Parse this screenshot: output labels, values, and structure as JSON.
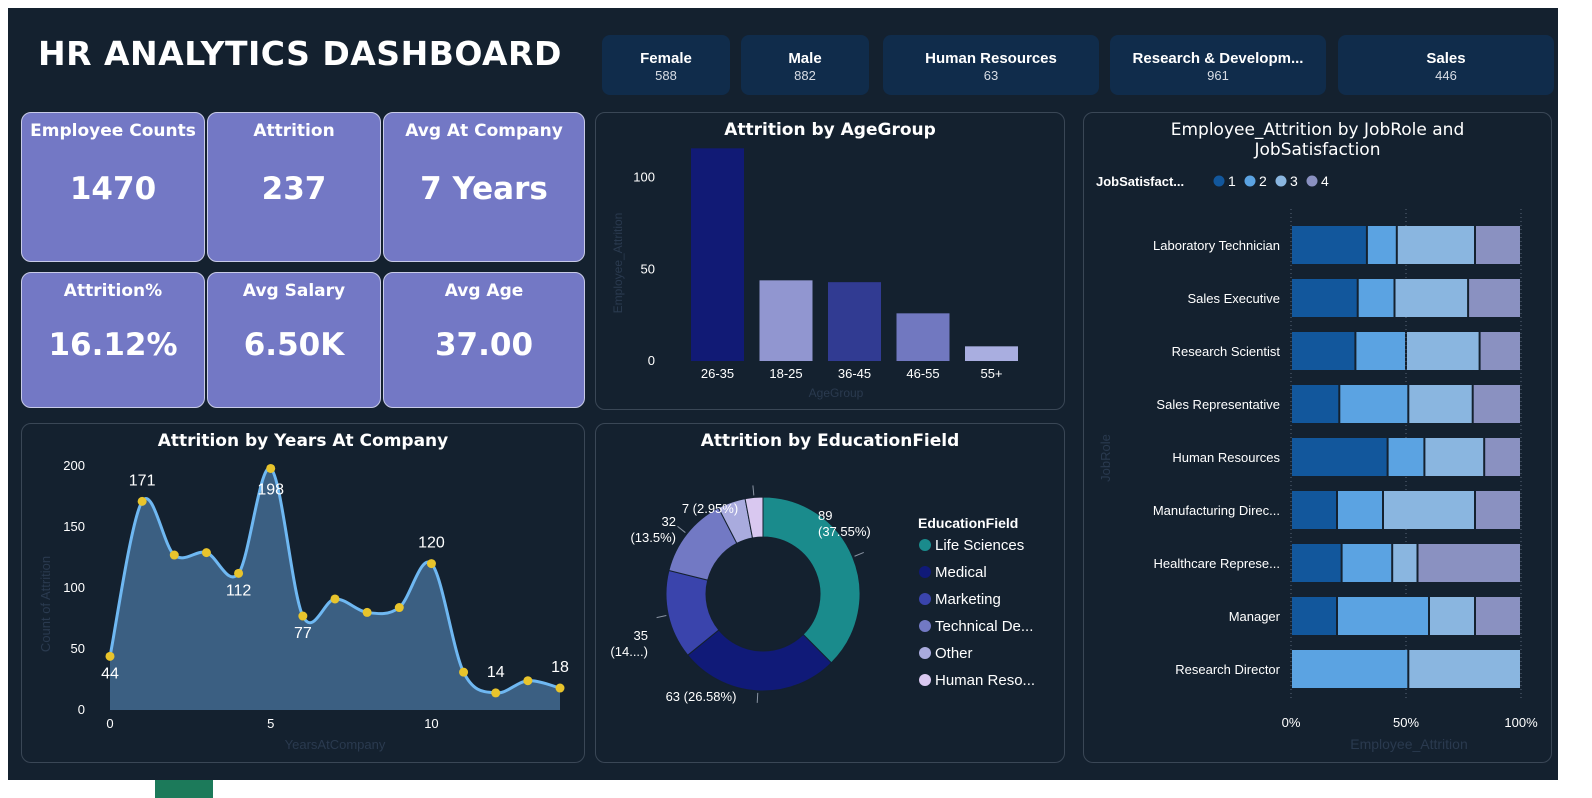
{
  "title": "HR ANALYTICS DASHBOARD",
  "slicers": [
    {
      "label": "Female",
      "value": "588"
    },
    {
      "label": "Male",
      "value": "882"
    },
    {
      "label": "Human Resources",
      "value": "63"
    },
    {
      "label": "Research & Developm...",
      "value": "961"
    },
    {
      "label": "Sales",
      "value": "446"
    }
  ],
  "kpis": [
    {
      "label": "Employee Counts",
      "value": "1470"
    },
    {
      "label": "Attrition",
      "value": "237"
    },
    {
      "label": "Avg At Company",
      "value": "7 Years"
    },
    {
      "label": "Attrition%",
      "value": "16.12%"
    },
    {
      "label": "Avg Salary",
      "value": "6.50K"
    },
    {
      "label": "Avg Age",
      "value": "37.00"
    }
  ],
  "colors": {
    "background": "#14212f",
    "kpi_card": "#7378c5",
    "slicer": "#102c4b",
    "line": "#6fb8f2",
    "area": "#3b5f82",
    "marker": "#e8c42c"
  },
  "chart_data": [
    {
      "type": "bar",
      "title": "Attrition by AgeGroup",
      "xlabel": "AgeGroup",
      "ylabel": "Employee_Attrition",
      "categories": [
        "26-35",
        "18-25",
        "36-45",
        "46-55",
        "55+"
      ],
      "values": [
        116,
        44,
        43,
        26,
        8
      ],
      "colors": [
        "#111a75",
        "#9196d0",
        "#313b92",
        "#7178c0",
        "#a9aee0"
      ],
      "yticks": [
        0,
        50,
        100
      ],
      "ylim": [
        0,
        120
      ],
      "grid": false
    },
    {
      "type": "area",
      "title": "Attrition by Years At Company",
      "xlabel": "YearsAtCompany",
      "ylabel": "Count of Attrition",
      "x": [
        0,
        1,
        2,
        3,
        4,
        5,
        6,
        7,
        8,
        9,
        10,
        11,
        12,
        13,
        14
      ],
      "values": [
        44,
        171,
        127,
        129,
        112,
        198,
        77,
        91,
        80,
        84,
        120,
        31,
        14,
        24,
        18
      ],
      "data_labels": [
        {
          "x": 0,
          "text": "44"
        },
        {
          "x": 1,
          "text": "171"
        },
        {
          "x": 4,
          "text": "112"
        },
        {
          "x": 5,
          "text": "198"
        },
        {
          "x": 6,
          "text": "77"
        },
        {
          "x": 10,
          "text": "120"
        },
        {
          "x": 12,
          "text": "14"
        },
        {
          "x": 14,
          "text": "18"
        }
      ],
      "xticks": [
        0,
        5,
        10
      ],
      "yticks": [
        0,
        50,
        100,
        150,
        200
      ],
      "xlim": [
        0,
        14
      ],
      "ylim": [
        0,
        200
      ],
      "grid": false
    },
    {
      "type": "pie",
      "title": "Attrition by EducationField",
      "legend_title": "EducationField",
      "legend_position": "right",
      "slices": [
        {
          "name": "Life Sciences",
          "legend": "Life Sciences",
          "value": 89,
          "label": "89\n(37.55%)",
          "color": "#1a8b8c"
        },
        {
          "name": "Medical",
          "legend": "Medical",
          "value": 63,
          "label": "63 (26.58%)",
          "color": "#101a78"
        },
        {
          "name": "Marketing",
          "legend": "Marketing",
          "value": 35,
          "label": "35\n(14....)",
          "color": "#3a44ac"
        },
        {
          "name": "Technical Degree",
          "legend": "Technical De...",
          "value": 32,
          "label": "32\n(13.5%)",
          "color": "#7279c4"
        },
        {
          "name": "Other",
          "legend": "Other",
          "value": 11,
          "label": "",
          "color": "#a9abde"
        },
        {
          "name": "Human Resources",
          "legend": "Human Reso...",
          "value": 7,
          "label": "7 (2.95%)",
          "color": "#d9c8f0"
        }
      ]
    },
    {
      "type": "bar",
      "orientation": "horizontal",
      "stacked": "100%",
      "title": "Employee_Attrition by JobRole and JobSatisfaction",
      "xlabel": "Employee_Attrition",
      "ylabel": "JobRole",
      "legend_title": "JobSatisfact...",
      "legend_position": "top-left",
      "categories": [
        "Laboratory Technician",
        "Sales Executive",
        "Research Scientist",
        "Sales Representative",
        "Human Resources",
        "Manufacturing Direc...",
        "Healthcare Represe...",
        "Manager",
        "Research Director"
      ],
      "series": [
        {
          "name": "1",
          "color": "#12579c",
          "values": [
            33,
            29,
            28,
            21,
            42,
            20,
            22,
            20,
            0
          ]
        },
        {
          "name": "2",
          "color": "#5ba3e2",
          "values": [
            13,
            16,
            22,
            30,
            16,
            20,
            22,
            40,
            51
          ]
        },
        {
          "name": "3",
          "color": "#8ab6e0",
          "values": [
            34,
            32,
            32,
            28,
            26,
            40,
            11,
            20,
            49
          ]
        },
        {
          "name": "4",
          "color": "#8a91c1",
          "values": [
            20,
            23,
            18,
            21,
            16,
            20,
            45,
            20,
            0
          ]
        }
      ],
      "xticks": [
        "0%",
        "50%",
        "100%"
      ],
      "xlim": [
        0,
        100
      ]
    }
  ]
}
